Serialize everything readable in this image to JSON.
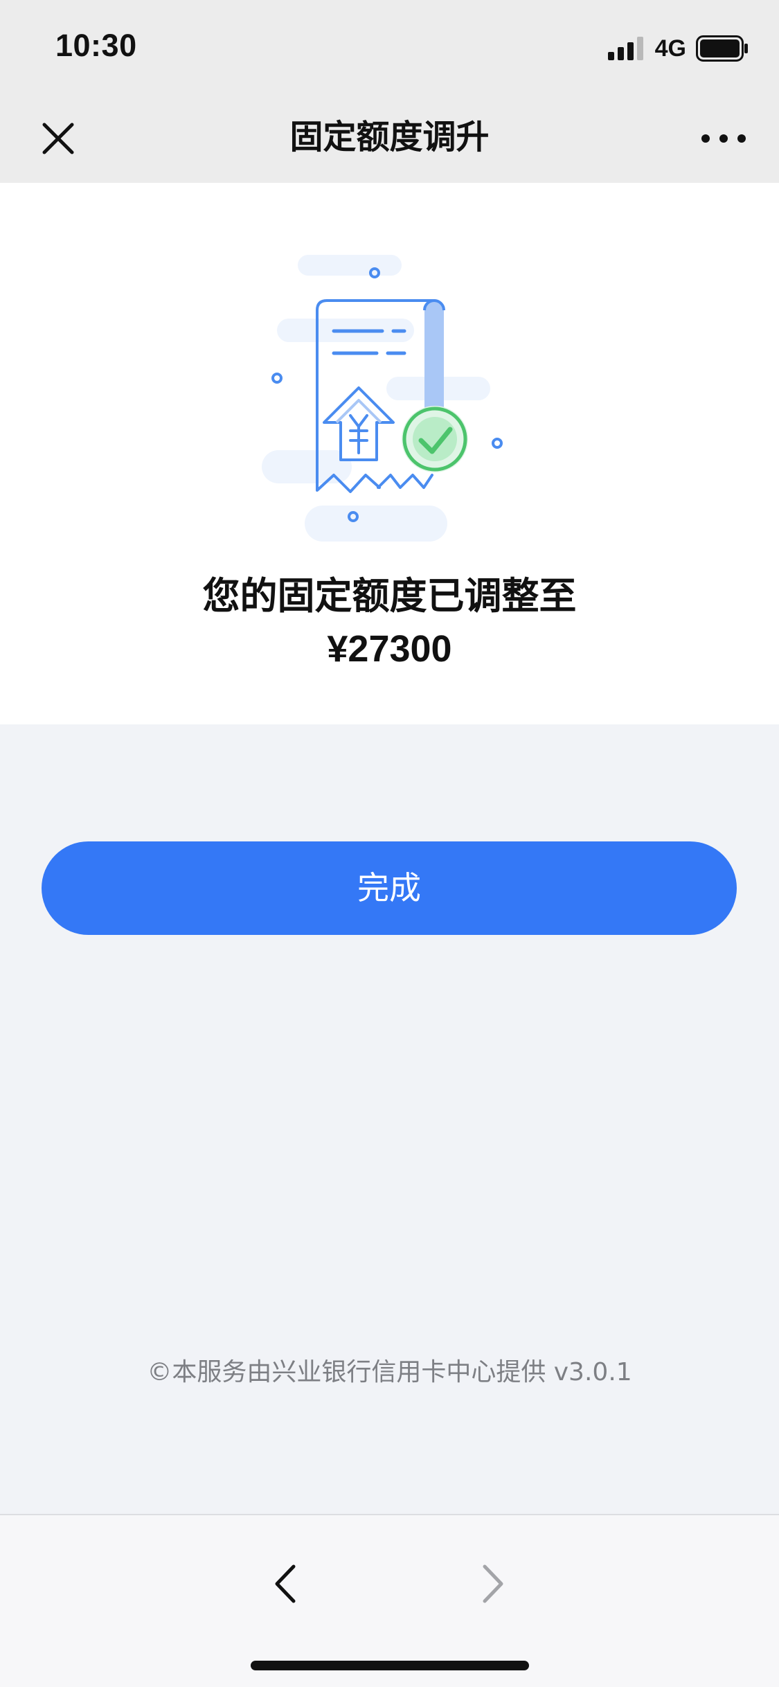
{
  "status_bar": {
    "time": "10:30",
    "network": "4G",
    "icons": [
      "signal-icon",
      "battery-icon"
    ]
  },
  "nav": {
    "title": "固定额度调升",
    "icons": [
      "close-icon",
      "more-icon"
    ]
  },
  "result": {
    "message": "您的固定额度已调整至",
    "amount": "¥27300",
    "illustration": "receipt-approved-illustration"
  },
  "actions": {
    "done_label": "完成"
  },
  "footer": {
    "text": "©本服务由兴业银行信用卡中心提供 v3.0.1"
  },
  "toolbar": {
    "icons": [
      "chevron-left-icon",
      "chevron-right-icon"
    ]
  },
  "colors": {
    "accent": "#3478f6",
    "success": "#4cc46c",
    "illustration_blue": "#4a8cf0",
    "page_background": "#f1f3f7",
    "bar_background": "#ececec"
  }
}
